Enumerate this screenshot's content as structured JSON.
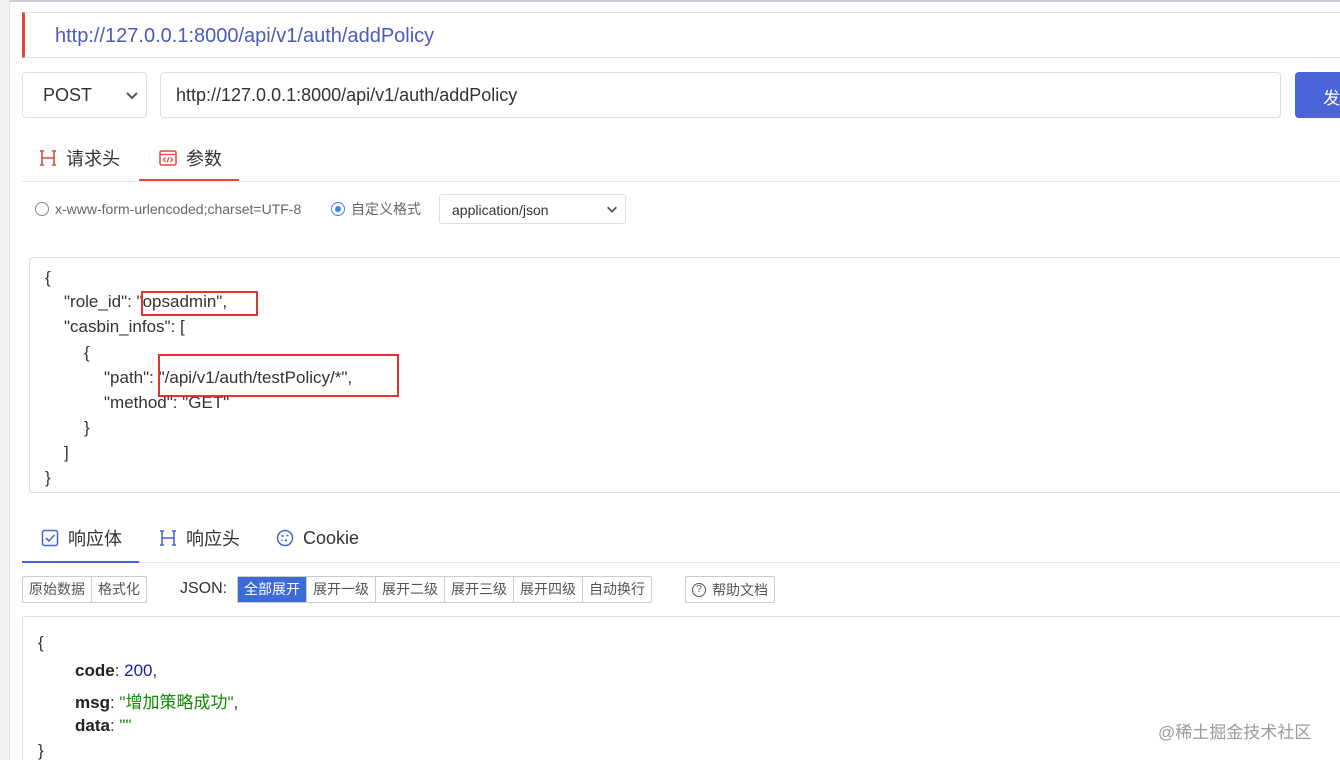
{
  "title_bar": {
    "url": "http://127.0.0.1:8000/api/v1/auth/addPolicy"
  },
  "request": {
    "method": "POST",
    "url": "http://127.0.0.1:8000/api/v1/auth/addPolicy",
    "send_label": "发送"
  },
  "request_tabs": [
    {
      "label": "请求头",
      "icon": "header-h-icon"
    },
    {
      "label": "参数",
      "icon": "code-window-icon",
      "active": true
    }
  ],
  "body_options": {
    "radio_urlencoded": "x-www-form-urlencoded;charset=UTF-8",
    "radio_custom": "自定义格式",
    "content_type": "application/json"
  },
  "body_lines": [
    "{",
    "\"role_id\": \"opsadmin\",",
    "\"casbin_infos\": [",
    "{",
    "\"path\": \"/api/v1/auth/testPolicy/*\",",
    "\"method\": \"GET\"",
    "}",
    "]",
    "}"
  ],
  "response_tabs": [
    {
      "label": "响应体",
      "icon": "checkbox-icon",
      "active": true
    },
    {
      "label": "响应头",
      "icon": "header-h-icon"
    },
    {
      "label": "Cookie",
      "icon": "cookie-icon"
    }
  ],
  "response_toolbar": {
    "raw": "原始数据",
    "format": "格式化",
    "json_label": "JSON:",
    "expand_all": "全部展开",
    "level1": "展开一级",
    "level2": "展开二级",
    "level3": "展开三级",
    "level4": "展开四级",
    "wrap": "自动换行",
    "help": "帮助文档"
  },
  "response_body": {
    "open": "{",
    "code_key": "code",
    "code_val": "200",
    "msg_key": "msg",
    "msg_val": "\"增加策略成功\"",
    "data_key": "data",
    "data_val": "\"\"",
    "close": "}"
  },
  "watermark": "@稀土掘金技术社区",
  "colors": {
    "accent_red": "#e0493a",
    "primary_blue": "#4a63d6",
    "highlight_box": "#e0352f"
  }
}
